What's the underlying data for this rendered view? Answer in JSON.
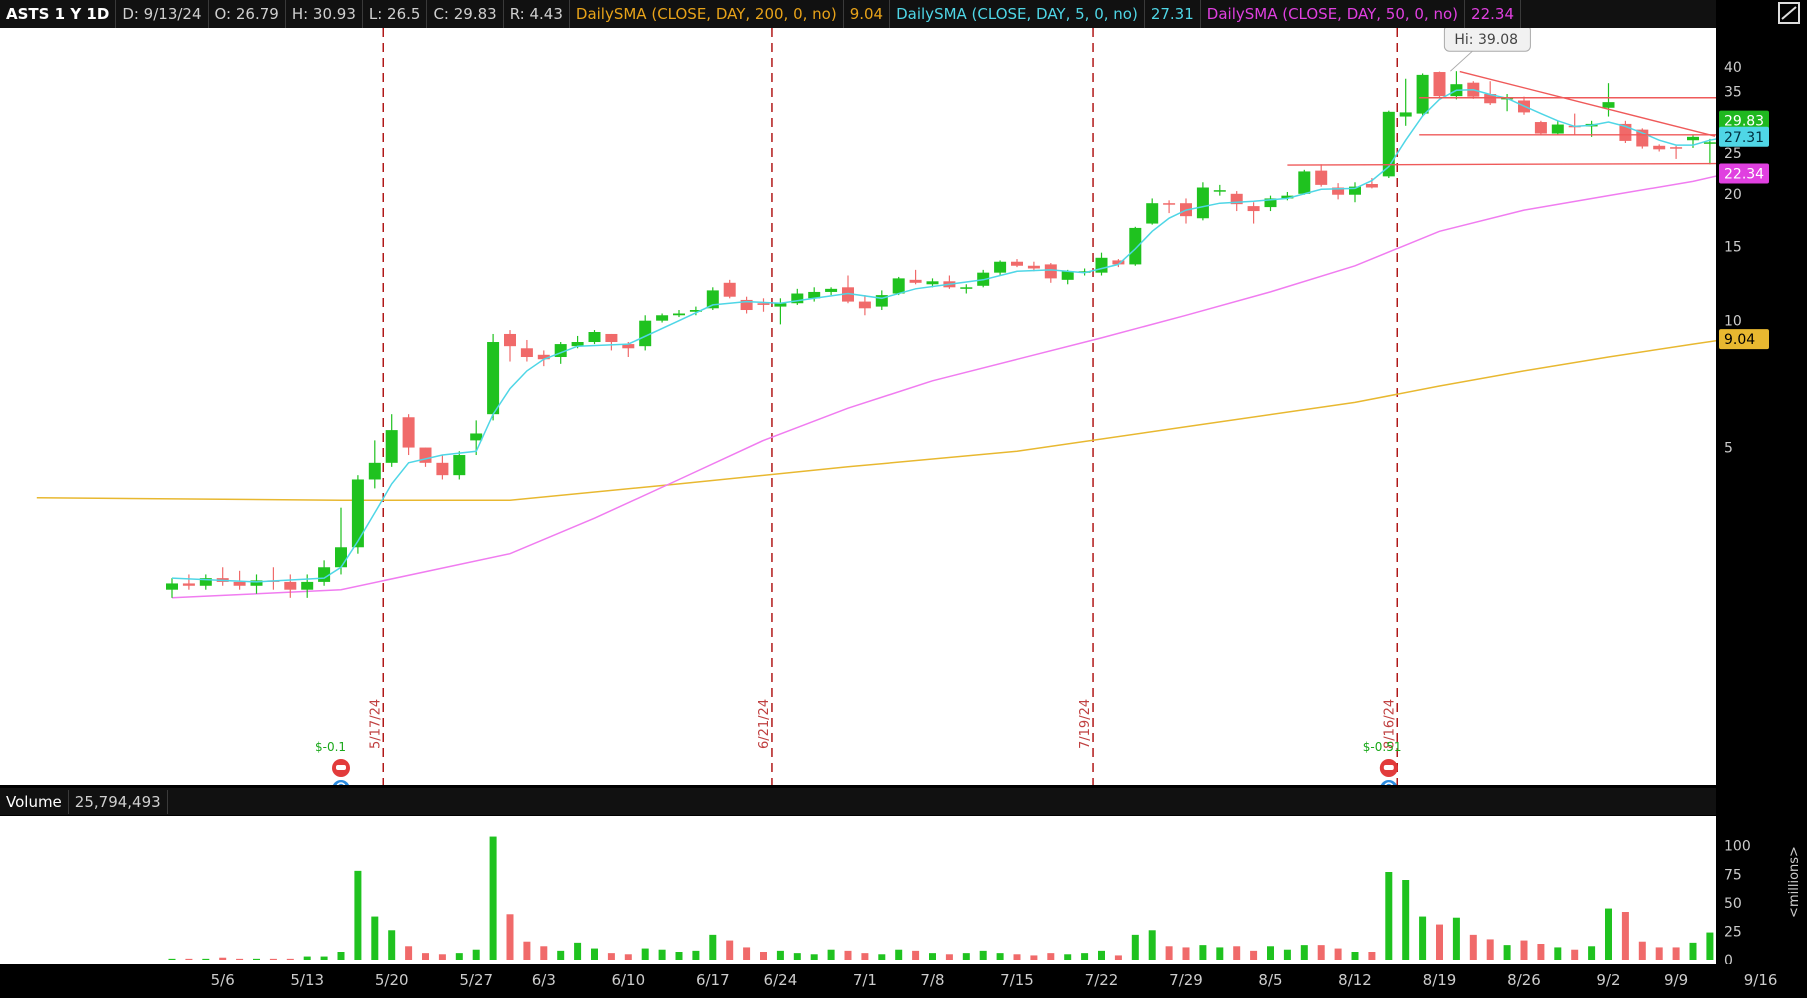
{
  "header": {
    "symbol": "ASTS 1 Y 1D",
    "date": "D: 9/13/24",
    "open": "O: 26.79",
    "high": "H: 30.93",
    "low": "L: 26.5",
    "close": "C: 29.83",
    "range": "R: 4.43",
    "sma200_label": "DailySMA (CLOSE, DAY, 200, 0, no)",
    "sma200_value": "9.04",
    "sma5_label": "DailySMA (CLOSE, DAY, 5, 0, no)",
    "sma5_value": "27.31",
    "sma50_label": "DailySMA (CLOSE, DAY, 50, 0, no)",
    "sma50_value": "22.34"
  },
  "volume_header": {
    "label": "Volume",
    "value": "25,794,493"
  },
  "colors": {
    "up": "#1fc21f",
    "down": "#f06a6a",
    "sma5": "#4fd6e6",
    "sma50": "#f07cf0",
    "sma200": "#e8b830",
    "trend": "#ef5a5a",
    "marker": "#b01818"
  },
  "icons": {
    "corner": "draw-tools-icon",
    "earnings": "earnings-phone-icon",
    "bulb": "lightbulb-icon"
  },
  "chart_data": {
    "type": "candlestick",
    "price_axis_ticks": [
      "40",
      "35",
      "25",
      "20",
      "15",
      "10",
      "5"
    ],
    "price_ylim": [
      0.8,
      42
    ],
    "volume_axis_ticks": [
      "100",
      "75",
      "50",
      "25",
      "0"
    ],
    "volume_unit": "<millions>",
    "volume_ylim": [
      0,
      112
    ],
    "x_ticks": [
      {
        "label": "5/6",
        "i": 3
      },
      {
        "label": "5/13",
        "i": 8
      },
      {
        "label": "5/20",
        "i": 13
      },
      {
        "label": "5/27",
        "i": 18
      },
      {
        "label": "6/3",
        "i": 22
      },
      {
        "label": "6/10",
        "i": 27
      },
      {
        "label": "6/17",
        "i": 32
      },
      {
        "label": "6/24",
        "i": 36
      },
      {
        "label": "7/1",
        "i": 41
      },
      {
        "label": "7/8",
        "i": 45
      },
      {
        "label": "7/15",
        "i": 50
      },
      {
        "label": "7/22",
        "i": 55
      },
      {
        "label": "7/29",
        "i": 60
      },
      {
        "label": "8/5",
        "i": 65
      },
      {
        "label": "8/12",
        "i": 70
      },
      {
        "label": "8/19",
        "i": 75
      },
      {
        "label": "8/26",
        "i": 80
      },
      {
        "label": "9/2",
        "i": 85
      },
      {
        "label": "9/9",
        "i": 89
      },
      {
        "label": "9/16",
        "i": 94
      }
    ],
    "candles": [
      {
        "o": 2.3,
        "h": 2.45,
        "l": 2.2,
        "c": 2.38,
        "v": 1
      },
      {
        "o": 2.38,
        "h": 2.5,
        "l": 2.3,
        "c": 2.35,
        "v": 1
      },
      {
        "o": 2.35,
        "h": 2.5,
        "l": 2.3,
        "c": 2.45,
        "v": 1
      },
      {
        "o": 2.45,
        "h": 2.6,
        "l": 2.35,
        "c": 2.4,
        "v": 2
      },
      {
        "o": 2.4,
        "h": 2.55,
        "l": 2.3,
        "c": 2.35,
        "v": 1
      },
      {
        "o": 2.35,
        "h": 2.5,
        "l": 2.25,
        "c": 2.42,
        "v": 1
      },
      {
        "o": 2.42,
        "h": 2.6,
        "l": 2.3,
        "c": 2.4,
        "v": 1
      },
      {
        "o": 2.4,
        "h": 2.5,
        "l": 2.2,
        "c": 2.3,
        "v": 1
      },
      {
        "o": 2.3,
        "h": 2.5,
        "l": 2.2,
        "c": 2.4,
        "v": 3
      },
      {
        "o": 2.4,
        "h": 2.7,
        "l": 2.35,
        "c": 2.6,
        "v": 3
      },
      {
        "o": 2.6,
        "h": 3.6,
        "l": 2.5,
        "c": 2.9,
        "v": 7
      },
      {
        "o": 2.9,
        "h": 4.3,
        "l": 2.8,
        "c": 4.2,
        "v": 78
      },
      {
        "o": 4.2,
        "h": 5.2,
        "l": 4.0,
        "c": 4.6,
        "v": 38
      },
      {
        "o": 4.6,
        "h": 6.0,
        "l": 4.5,
        "c": 5.5,
        "v": 26
      },
      {
        "o": 5.9,
        "h": 6.0,
        "l": 4.8,
        "c": 5.0,
        "v": 12
      },
      {
        "o": 5.0,
        "h": 5.0,
        "l": 4.5,
        "c": 4.6,
        "v": 6
      },
      {
        "o": 4.6,
        "h": 4.8,
        "l": 4.2,
        "c": 4.3,
        "v": 5
      },
      {
        "o": 4.3,
        "h": 4.9,
        "l": 4.2,
        "c": 4.8,
        "v": 6
      },
      {
        "o": 5.2,
        "h": 5.8,
        "l": 4.8,
        "c": 5.4,
        "v": 9
      },
      {
        "o": 6.0,
        "h": 9.3,
        "l": 5.8,
        "c": 8.9,
        "v": 108
      },
      {
        "o": 9.3,
        "h": 9.5,
        "l": 8.0,
        "c": 8.7,
        "v": 40
      },
      {
        "o": 8.6,
        "h": 9.0,
        "l": 8.0,
        "c": 8.2,
        "v": 16
      },
      {
        "o": 8.3,
        "h": 8.5,
        "l": 7.8,
        "c": 8.1,
        "v": 12
      },
      {
        "o": 8.2,
        "h": 8.9,
        "l": 7.9,
        "c": 8.8,
        "v": 8
      },
      {
        "o": 8.7,
        "h": 9.2,
        "l": 8.6,
        "c": 8.9,
        "v": 15
      },
      {
        "o": 8.9,
        "h": 9.5,
        "l": 8.8,
        "c": 9.4,
        "v": 10
      },
      {
        "o": 9.3,
        "h": 9.3,
        "l": 8.5,
        "c": 8.9,
        "v": 6
      },
      {
        "o": 8.8,
        "h": 8.9,
        "l": 8.2,
        "c": 8.6,
        "v": 5
      },
      {
        "o": 8.7,
        "h": 10.3,
        "l": 8.5,
        "c": 10.0,
        "v": 10
      },
      {
        "o": 10.0,
        "h": 10.4,
        "l": 9.9,
        "c": 10.3,
        "v": 9
      },
      {
        "o": 10.3,
        "h": 10.6,
        "l": 10.2,
        "c": 10.4,
        "v": 7
      },
      {
        "o": 10.5,
        "h": 10.8,
        "l": 10.3,
        "c": 10.6,
        "v": 8
      },
      {
        "o": 10.7,
        "h": 12.0,
        "l": 10.6,
        "c": 11.8,
        "v": 22
      },
      {
        "o": 12.3,
        "h": 12.5,
        "l": 11.3,
        "c": 11.4,
        "v": 17
      },
      {
        "o": 11.2,
        "h": 11.4,
        "l": 10.4,
        "c": 10.6,
        "v": 11
      },
      {
        "o": 11.0,
        "h": 11.3,
        "l": 10.5,
        "c": 10.9,
        "v": 7
      },
      {
        "o": 10.8,
        "h": 11.3,
        "l": 9.8,
        "c": 11.0,
        "v": 8
      },
      {
        "o": 11.0,
        "h": 11.9,
        "l": 10.9,
        "c": 11.6,
        "v": 6
      },
      {
        "o": 11.3,
        "h": 12.0,
        "l": 11.1,
        "c": 11.7,
        "v": 5
      },
      {
        "o": 11.7,
        "h": 12.0,
        "l": 11.5,
        "c": 11.9,
        "v": 9
      },
      {
        "o": 12.0,
        "h": 12.8,
        "l": 11.0,
        "c": 11.1,
        "v": 8
      },
      {
        "o": 11.1,
        "h": 11.5,
        "l": 10.3,
        "c": 10.7,
        "v": 6
      },
      {
        "o": 10.8,
        "h": 11.8,
        "l": 10.6,
        "c": 11.5,
        "v": 5
      },
      {
        "o": 11.6,
        "h": 12.7,
        "l": 11.5,
        "c": 12.6,
        "v": 9
      },
      {
        "o": 12.5,
        "h": 13.2,
        "l": 12.2,
        "c": 12.3,
        "v": 8
      },
      {
        "o": 12.2,
        "h": 12.6,
        "l": 12.0,
        "c": 12.4,
        "v": 6
      },
      {
        "o": 12.4,
        "h": 12.8,
        "l": 11.9,
        "c": 12.0,
        "v": 5
      },
      {
        "o": 12.0,
        "h": 12.2,
        "l": 11.6,
        "c": 12.0,
        "v": 6
      },
      {
        "o": 12.1,
        "h": 13.2,
        "l": 12.0,
        "c": 13.0,
        "v": 8
      },
      {
        "o": 13.0,
        "h": 13.9,
        "l": 12.8,
        "c": 13.8,
        "v": 6
      },
      {
        "o": 13.8,
        "h": 14.0,
        "l": 13.4,
        "c": 13.5,
        "v": 5
      },
      {
        "o": 13.5,
        "h": 13.8,
        "l": 13.1,
        "c": 13.3,
        "v": 4
      },
      {
        "o": 13.6,
        "h": 13.7,
        "l": 12.3,
        "c": 12.6,
        "v": 6
      },
      {
        "o": 12.5,
        "h": 13.2,
        "l": 12.2,
        "c": 13.1,
        "v": 5
      },
      {
        "o": 13.0,
        "h": 13.3,
        "l": 12.8,
        "c": 13.1,
        "v": 6
      },
      {
        "o": 13.0,
        "h": 14.5,
        "l": 12.8,
        "c": 14.1,
        "v": 8
      },
      {
        "o": 13.9,
        "h": 14.0,
        "l": 13.4,
        "c": 13.6,
        "v": 4
      },
      {
        "o": 13.6,
        "h": 16.7,
        "l": 13.5,
        "c": 16.6,
        "v": 22
      },
      {
        "o": 17.0,
        "h": 19.5,
        "l": 16.9,
        "c": 19.0,
        "v": 26
      },
      {
        "o": 19.0,
        "h": 19.3,
        "l": 18.0,
        "c": 18.9,
        "v": 12
      },
      {
        "o": 19.0,
        "h": 19.5,
        "l": 17.0,
        "c": 17.7,
        "v": 11
      },
      {
        "o": 17.5,
        "h": 21.3,
        "l": 17.3,
        "c": 20.7,
        "v": 13
      },
      {
        "o": 20.4,
        "h": 21.0,
        "l": 19.8,
        "c": 20.4,
        "v": 11
      },
      {
        "o": 20.0,
        "h": 20.3,
        "l": 18.2,
        "c": 18.9,
        "v": 12
      },
      {
        "o": 18.7,
        "h": 19.1,
        "l": 17.0,
        "c": 18.2,
        "v": 8
      },
      {
        "o": 18.6,
        "h": 19.8,
        "l": 18.2,
        "c": 19.5,
        "v": 12
      },
      {
        "o": 19.5,
        "h": 20.2,
        "l": 19.3,
        "c": 19.8,
        "v": 9
      },
      {
        "o": 20.0,
        "h": 22.8,
        "l": 19.9,
        "c": 22.6,
        "v": 13
      },
      {
        "o": 22.7,
        "h": 23.5,
        "l": 20.8,
        "c": 21.0,
        "v": 13
      },
      {
        "o": 20.7,
        "h": 21.2,
        "l": 19.4,
        "c": 19.9,
        "v": 10
      },
      {
        "o": 19.9,
        "h": 21.3,
        "l": 19.1,
        "c": 20.8,
        "v": 7
      },
      {
        "o": 21.1,
        "h": 21.8,
        "l": 20.6,
        "c": 20.7,
        "v": 7
      },
      {
        "o": 22.0,
        "h": 31.5,
        "l": 21.8,
        "c": 31.3,
        "v": 77
      },
      {
        "o": 30.5,
        "h": 37.5,
        "l": 29.0,
        "c": 31.2,
        "v": 70
      },
      {
        "o": 31.0,
        "h": 38.6,
        "l": 30.5,
        "c": 38.3,
        "v": 38
      },
      {
        "o": 38.9,
        "h": 39.0,
        "l": 33.8,
        "c": 34.1,
        "v": 31
      },
      {
        "o": 34.1,
        "h": 39.08,
        "l": 33.5,
        "c": 36.4,
        "v": 37
      },
      {
        "o": 36.7,
        "h": 37.0,
        "l": 33.6,
        "c": 34.0,
        "v": 22
      },
      {
        "o": 34.5,
        "h": 37.0,
        "l": 32.5,
        "c": 32.8,
        "v": 18
      },
      {
        "o": 33.5,
        "h": 34.5,
        "l": 31.4,
        "c": 33.9,
        "v": 13
      },
      {
        "o": 33.3,
        "h": 34.0,
        "l": 30.8,
        "c": 31.2,
        "v": 17
      },
      {
        "o": 29.6,
        "h": 29.8,
        "l": 27.6,
        "c": 27.8,
        "v": 14
      },
      {
        "o": 27.8,
        "h": 29.8,
        "l": 27.5,
        "c": 29.2,
        "v": 11
      },
      {
        "o": 29.0,
        "h": 31.0,
        "l": 27.5,
        "c": 28.8,
        "v": 9
      },
      {
        "o": 28.9,
        "h": 29.8,
        "l": 27.3,
        "c": 29.3,
        "v": 12
      },
      {
        "o": 32.0,
        "h": 36.6,
        "l": 30.5,
        "c": 33.0,
        "v": 45
      },
      {
        "o": 29.3,
        "h": 29.8,
        "l": 26.4,
        "c": 26.7,
        "v": 42
      },
      {
        "o": 28.4,
        "h": 28.6,
        "l": 25.6,
        "c": 25.9,
        "v": 16
      },
      {
        "o": 26.0,
        "h": 26.2,
        "l": 25.2,
        "c": 25.5,
        "v": 11
      },
      {
        "o": 25.8,
        "h": 26.0,
        "l": 24.2,
        "c": 25.6,
        "v": 11
      },
      {
        "o": 26.8,
        "h": 27.5,
        "l": 25.7,
        "c": 27.3,
        "v": 15
      },
      {
        "o": 26.4,
        "h": 27.0,
        "l": 23.5,
        "c": 26.5,
        "v": 24
      },
      {
        "o": 26.79,
        "h": 30.93,
        "l": 26.5,
        "c": 29.83,
        "v": 25.8
      }
    ],
    "sma5": [
      {
        "i": 0,
        "y": 2.45
      },
      {
        "i": 5,
        "y": 2.4
      },
      {
        "i": 9,
        "y": 2.45
      },
      {
        "i": 10,
        "y": 2.6
      },
      {
        "i": 11,
        "y": 3.0
      },
      {
        "i": 12,
        "y": 3.5
      },
      {
        "i": 13,
        "y": 4.1
      },
      {
        "i": 14,
        "y": 4.6
      },
      {
        "i": 16,
        "y": 4.8
      },
      {
        "i": 18,
        "y": 4.9
      },
      {
        "i": 19,
        "y": 6.0
      },
      {
        "i": 20,
        "y": 6.9
      },
      {
        "i": 21,
        "y": 7.6
      },
      {
        "i": 22,
        "y": 8.1
      },
      {
        "i": 24,
        "y": 8.7
      },
      {
        "i": 27,
        "y": 8.8
      },
      {
        "i": 30,
        "y": 10.0
      },
      {
        "i": 32,
        "y": 10.9
      },
      {
        "i": 34,
        "y": 11.1
      },
      {
        "i": 36,
        "y": 11.0
      },
      {
        "i": 38,
        "y": 11.3
      },
      {
        "i": 40,
        "y": 11.6
      },
      {
        "i": 42,
        "y": 11.3
      },
      {
        "i": 44,
        "y": 11.9
      },
      {
        "i": 46,
        "y": 12.2
      },
      {
        "i": 48,
        "y": 12.5
      },
      {
        "i": 50,
        "y": 13.1
      },
      {
        "i": 52,
        "y": 13.2
      },
      {
        "i": 54,
        "y": 13.0
      },
      {
        "i": 56,
        "y": 13.6
      },
      {
        "i": 57,
        "y": 14.8
      },
      {
        "i": 58,
        "y": 16.3
      },
      {
        "i": 59,
        "y": 17.5
      },
      {
        "i": 60,
        "y": 18.3
      },
      {
        "i": 62,
        "y": 19.0
      },
      {
        "i": 64,
        "y": 19.2
      },
      {
        "i": 66,
        "y": 19.5
      },
      {
        "i": 68,
        "y": 20.5
      },
      {
        "i": 70,
        "y": 20.6
      },
      {
        "i": 71,
        "y": 21.5
      },
      {
        "i": 72,
        "y": 23.2
      },
      {
        "i": 73,
        "y": 26.8
      },
      {
        "i": 74,
        "y": 30.6
      },
      {
        "i": 75,
        "y": 33.5
      },
      {
        "i": 76,
        "y": 35.2
      },
      {
        "i": 77,
        "y": 35.3
      },
      {
        "i": 78,
        "y": 34.4
      },
      {
        "i": 79,
        "y": 33.7
      },
      {
        "i": 80,
        "y": 32.3
      },
      {
        "i": 81,
        "y": 31.0
      },
      {
        "i": 82,
        "y": 29.8
      },
      {
        "i": 83,
        "y": 28.9
      },
      {
        "i": 84,
        "y": 29.1
      },
      {
        "i": 85,
        "y": 29.6
      },
      {
        "i": 86,
        "y": 28.9
      },
      {
        "i": 87,
        "y": 27.9
      },
      {
        "i": 88,
        "y": 26.8
      },
      {
        "i": 89,
        "y": 26.1
      },
      {
        "i": 90,
        "y": 26.1
      },
      {
        "i": 91,
        "y": 26.8
      },
      {
        "i": 92,
        "y": 27.31
      }
    ],
    "sma50": [
      {
        "i": 0,
        "y": 2.2
      },
      {
        "i": 10,
        "y": 2.3
      },
      {
        "i": 20,
        "y": 2.8
      },
      {
        "i": 25,
        "y": 3.4
      },
      {
        "i": 30,
        "y": 4.2
      },
      {
        "i": 35,
        "y": 5.2
      },
      {
        "i": 40,
        "y": 6.2
      },
      {
        "i": 45,
        "y": 7.2
      },
      {
        "i": 50,
        "y": 8.1
      },
      {
        "i": 55,
        "y": 9.1
      },
      {
        "i": 60,
        "y": 10.3
      },
      {
        "i": 65,
        "y": 11.7
      },
      {
        "i": 70,
        "y": 13.5
      },
      {
        "i": 75,
        "y": 16.3
      },
      {
        "i": 80,
        "y": 18.3
      },
      {
        "i": 85,
        "y": 19.8
      },
      {
        "i": 90,
        "y": 21.4
      },
      {
        "i": 92,
        "y": 22.34
      }
    ],
    "sma200": [
      {
        "i": -8,
        "y": 3.8
      },
      {
        "i": 10,
        "y": 3.75
      },
      {
        "i": 20,
        "y": 3.75
      },
      {
        "i": 30,
        "y": 4.1
      },
      {
        "i": 40,
        "y": 4.5
      },
      {
        "i": 50,
        "y": 4.9
      },
      {
        "i": 60,
        "y": 5.6
      },
      {
        "i": 70,
        "y": 6.4
      },
      {
        "i": 75,
        "y": 7.0
      },
      {
        "i": 80,
        "y": 7.6
      },
      {
        "i": 85,
        "y": 8.2
      },
      {
        "i": 90,
        "y": 8.8
      },
      {
        "i": 92,
        "y": 9.04
      }
    ],
    "vertical_markers": [
      {
        "label": "5/17/24",
        "i": 12.5
      },
      {
        "label": "6/21/24",
        "i": 35.5
      },
      {
        "label": "7/19/24",
        "i": 54.5
      },
      {
        "label": "8/16/24",
        "i": 72.5
      }
    ],
    "earnings": [
      {
        "label": "$-0.1",
        "i": 10
      },
      {
        "label": "$-0.51",
        "i": 72
      }
    ],
    "annotation": {
      "label": "Hi: 39.08",
      "i": 76,
      "price": 39.08
    },
    "trend_lines": [
      {
        "i1": 76.2,
        "p1": 39.0,
        "i2": 91.3,
        "p2": 27.4
      },
      {
        "i1": 73.8,
        "p1": 33.8,
        "i2": 93.8,
        "p2": 33.8
      },
      {
        "i1": 73.8,
        "p1": 27.6,
        "i2": 93.8,
        "p2": 27.6
      },
      {
        "i1": 66.0,
        "p1": 23.4,
        "i2": 91.9,
        "p2": 23.6
      }
    ],
    "price_labels": [
      {
        "value": "29.83",
        "price": 29.83,
        "bg": "#1fb81f",
        "fg": "#ffffff"
      },
      {
        "value": "27.31",
        "price": 27.31,
        "bg": "#4fd6e6",
        "fg": "#003040"
      },
      {
        "value": "22.34",
        "price": 22.34,
        "bg": "#e040e0",
        "fg": "#ffffff"
      },
      {
        "value": "9.04",
        "price": 9.04,
        "bg": "#e8b830",
        "fg": "#000000"
      }
    ]
  }
}
